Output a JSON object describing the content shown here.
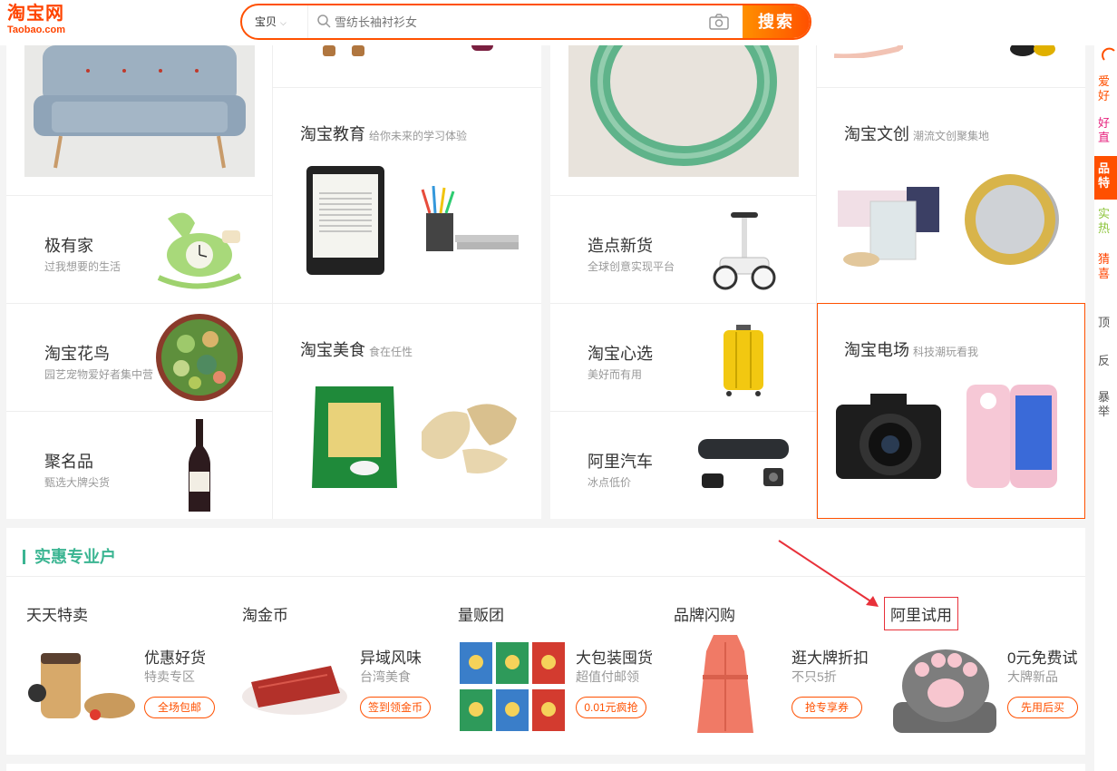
{
  "header": {
    "logo_cn": "淘宝网",
    "logo_en": "Taobao.com",
    "search_category": "宝贝",
    "search_placeholder": "雪纺长袖衬衫女",
    "search_button": "搜索"
  },
  "right_rail": [
    "爱好",
    "好直",
    "品特",
    "实热",
    "猜喜",
    "顶",
    "反",
    "暴举"
  ],
  "grid": {
    "left": [
      {
        "title": "极有家",
        "sub": "过我想要的生活"
      },
      {
        "title": "淘宝花鸟",
        "sub": "园艺宠物爱好者集中营"
      },
      {
        "title": "聚名品",
        "sub": "甄选大牌尖货"
      }
    ],
    "mid_left": [
      {
        "title": "淘宝教育",
        "sub": "给你未来的学习体验"
      },
      {
        "title": "淘宝美食",
        "sub": "食在任性"
      }
    ],
    "mid_right": [
      {
        "title": "造点新货",
        "sub": "全球创意实现平台"
      },
      {
        "title": "淘宝心选",
        "sub": "美好而有用"
      },
      {
        "title": "阿里汽车",
        "sub": "冰点低价"
      }
    ],
    "right": [
      {
        "title": "淘宝文创",
        "sub": "潮流文创聚集地"
      },
      {
        "title": "淘宝电场",
        "sub": "科技潮玩看我"
      }
    ]
  },
  "section": {
    "title": "实惠专业户",
    "deals": [
      {
        "title": "天天特卖",
        "headline": "优惠好货",
        "sub": "特卖专区",
        "button": "全场包邮"
      },
      {
        "title": "淘金币",
        "headline": "异域风味",
        "sub": "台湾美食",
        "button": "签到领金币"
      },
      {
        "title": "量贩团",
        "headline": "大包装囤货",
        "sub": "超值付邮领",
        "button": "0.01元疯抢"
      },
      {
        "title": "品牌闪购",
        "headline": "逛大牌折扣",
        "sub": "不只5折",
        "button": "抢专享券"
      },
      {
        "title": "阿里试用",
        "headline": "0元免费试",
        "sub": "大牌新品",
        "button": "先用后买"
      }
    ]
  },
  "colors": {
    "brand": "#ff5000",
    "accent_green": "#3bb592",
    "annotation_red": "#e8313a"
  }
}
